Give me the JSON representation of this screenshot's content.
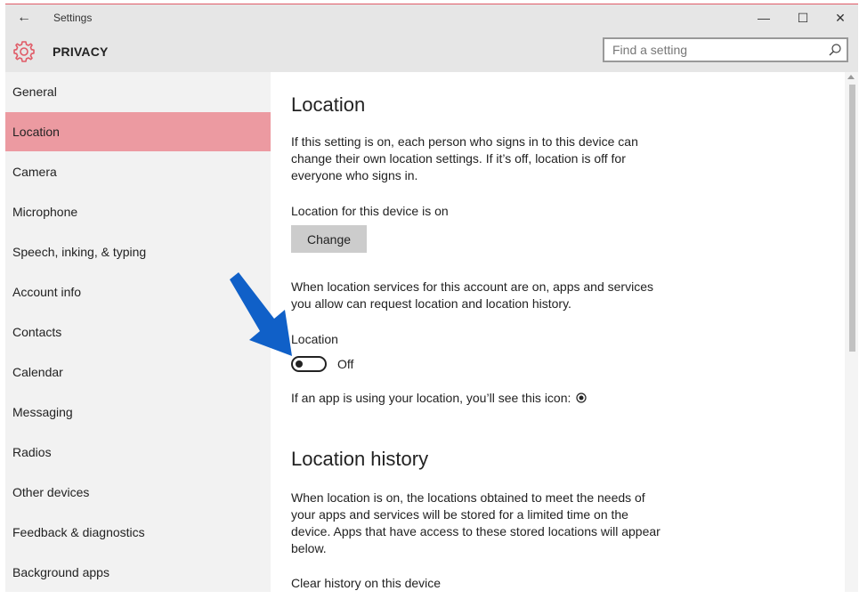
{
  "window": {
    "title": "Settings",
    "back_icon": "←",
    "min_icon": "—",
    "max_icon": "☐",
    "close_icon": "✕"
  },
  "header": {
    "title": "PRIVACY",
    "icon": "gear-icon",
    "search_placeholder": "Find a setting"
  },
  "sidebar": {
    "items": [
      {
        "label": "General"
      },
      {
        "label": "Location",
        "active": true
      },
      {
        "label": "Camera"
      },
      {
        "label": "Microphone"
      },
      {
        "label": "Speech, inking, & typing"
      },
      {
        "label": "Account info"
      },
      {
        "label": "Contacts"
      },
      {
        "label": "Calendar"
      },
      {
        "label": "Messaging"
      },
      {
        "label": "Radios"
      },
      {
        "label": "Other devices"
      },
      {
        "label": "Feedback & diagnostics"
      },
      {
        "label": "Background apps"
      }
    ]
  },
  "content": {
    "location_title": "Location",
    "location_desc": "If this setting is on, each person who signs in to this device can change their own location settings. If it’s off, location is off for everyone who signs in.",
    "device_status": "Location for this device is on",
    "change_button": "Change",
    "account_desc": "When location services for this account are on, apps and services you allow can request location and location history.",
    "toggle_label": "Location",
    "toggle_state": "Off",
    "icon_note": "If an app is using your location, you’ll see this icon:",
    "history_title": "Location history",
    "history_desc": "When location is on, the locations obtained to meet the needs of your apps and services will be stored for a limited time on the device. Apps that have access to these stored locations will appear below.",
    "clear_label": "Clear history on this device"
  },
  "colors": {
    "accent": "#e05a66",
    "active_nav": "#ec9aa1",
    "annotation_arrow": "#1060c8"
  }
}
